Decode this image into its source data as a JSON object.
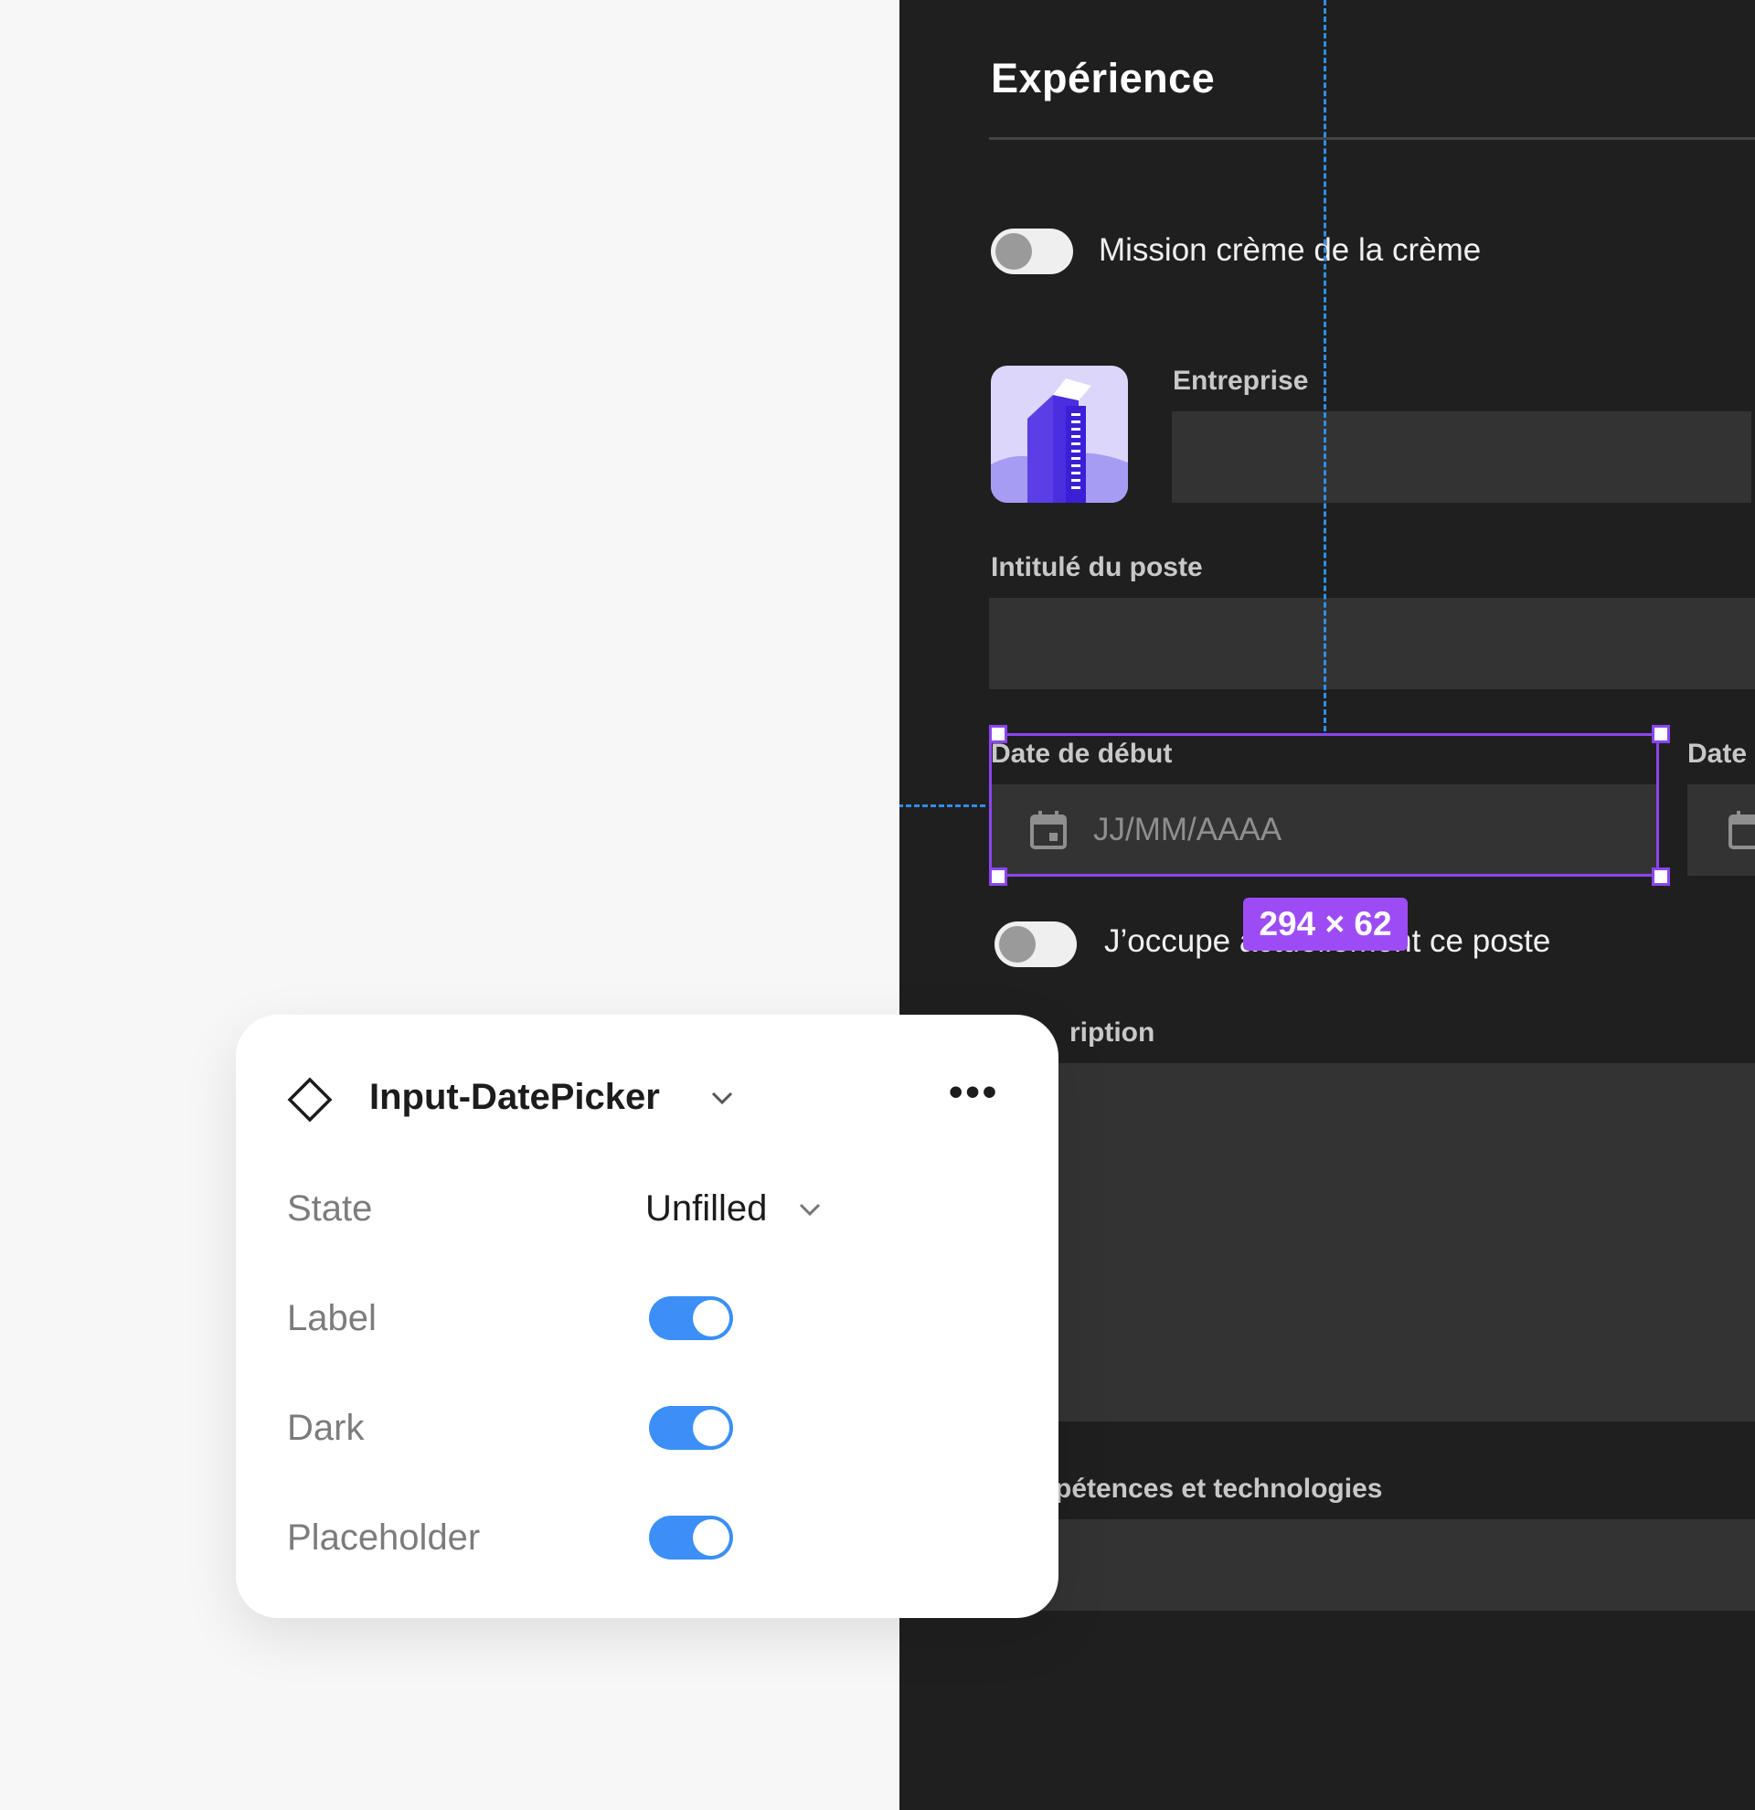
{
  "form": {
    "title": "Expérience",
    "mission_toggle_label": "Mission crème de la crème",
    "entreprise_label": "Entreprise",
    "intitule_label": "Intitulé du poste",
    "date_debut_label": "Date de début",
    "date_debut_placeholder": "JJ/MM/AAAA",
    "date_fin_label": "Date",
    "occupe_toggle_label": "J’occupe actuellement ce poste",
    "description_label": "ription",
    "competences_label": "pétences et technologies"
  },
  "selection": {
    "size_label": "294 × 62"
  },
  "properties_panel": {
    "component_name": "Input-DatePicker",
    "more_label": "•••",
    "properties": [
      {
        "label": "State",
        "value": "Unfilled"
      },
      {
        "label": "Label",
        "value": true
      },
      {
        "label": "Dark",
        "value": true
      },
      {
        "label": "Placeholder",
        "value": true
      }
    ]
  },
  "colors": {
    "dark_background": "#1f1f1f",
    "input_background": "#333333",
    "selection": "#8b45f0",
    "guide": "#2f8ff0",
    "toggle_on": "#3b8ff6"
  },
  "icons": [
    "calendar-icon",
    "building-logo-icon",
    "component-diamond-icon",
    "chevron-down-icon",
    "more-icon"
  ]
}
